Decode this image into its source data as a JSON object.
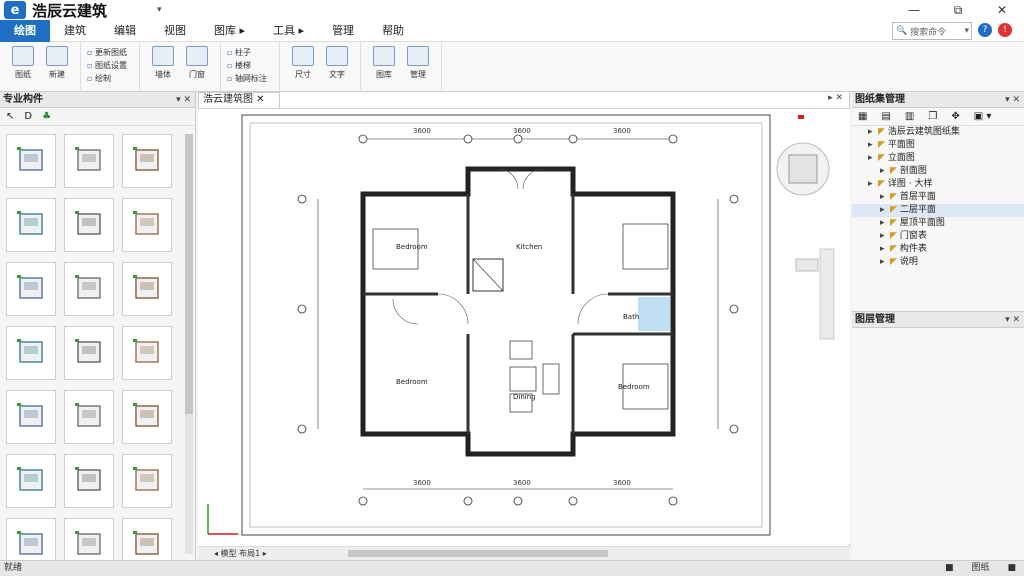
{
  "app": {
    "logo": "e",
    "title": "浩辰云建筑"
  },
  "window": {
    "minimize": "—",
    "maximize": "⧉",
    "close": "✕"
  },
  "menu": [
    {
      "label": "绘图",
      "active": true
    },
    {
      "label": "建筑"
    },
    {
      "label": "编辑"
    },
    {
      "label": "视图"
    },
    {
      "label": "图库 ▸"
    },
    {
      "label": "工具 ▸"
    },
    {
      "label": "管理"
    },
    {
      "label": "帮助"
    }
  ],
  "search": {
    "placeholder": "搜索命令"
  },
  "ribbon": {
    "big1": [
      "图纸",
      "新建"
    ],
    "small1": [
      "更新图纸",
      "图纸设置",
      "绘制"
    ],
    "big2": [
      "墙体",
      "门窗"
    ],
    "small2": [
      "柱子",
      "楼梯",
      "轴网标注"
    ],
    "big3": [
      "尺寸",
      "文字"
    ],
    "big4": [
      "图库",
      "管理"
    ]
  },
  "left_panel": {
    "title": "专业构件",
    "controls": "▾ ✕",
    "tools": [
      "↖",
      "D",
      "♣"
    ]
  },
  "canvas": {
    "tab": "浩云建筑图",
    "controls": "▸ ✕",
    "bottom_tab": "◂ 模型 布局1 ▸",
    "rooms": [
      "Bedroom",
      "Kitchen",
      "Bedroom",
      "Bedroom",
      "Dining",
      "Bath"
    ],
    "dims_top": [
      "3600",
      "3600",
      "3600"
    ],
    "dims_bottom": [
      "3600",
      "3600",
      "3600"
    ]
  },
  "right_panel": {
    "title": "图纸集管理",
    "controls": "▾ ✕",
    "tree": [
      {
        "label": "浩辰云建筑图纸集",
        "level": 1
      },
      {
        "label": "平面图",
        "level": 1
      },
      {
        "label": "立面图",
        "level": 1
      },
      {
        "label": "剖面图",
        "level": 2
      },
      {
        "label": "详图 · 大样",
        "level": 1
      },
      {
        "label": "首层平面",
        "level": 2
      },
      {
        "label": "二层平面",
        "level": 2,
        "selected": true
      },
      {
        "label": "屋顶平面图",
        "level": 2
      },
      {
        "label": "门窗表",
        "level": 2
      },
      {
        "label": "构件表",
        "level": 2
      },
      {
        "label": "说明",
        "level": 2
      }
    ],
    "props_title": "图层管理"
  },
  "status": {
    "left": "就绪",
    "right": [
      "■",
      "图纸",
      "■"
    ]
  },
  "colors": {
    "accent": "#1f6fc5"
  }
}
